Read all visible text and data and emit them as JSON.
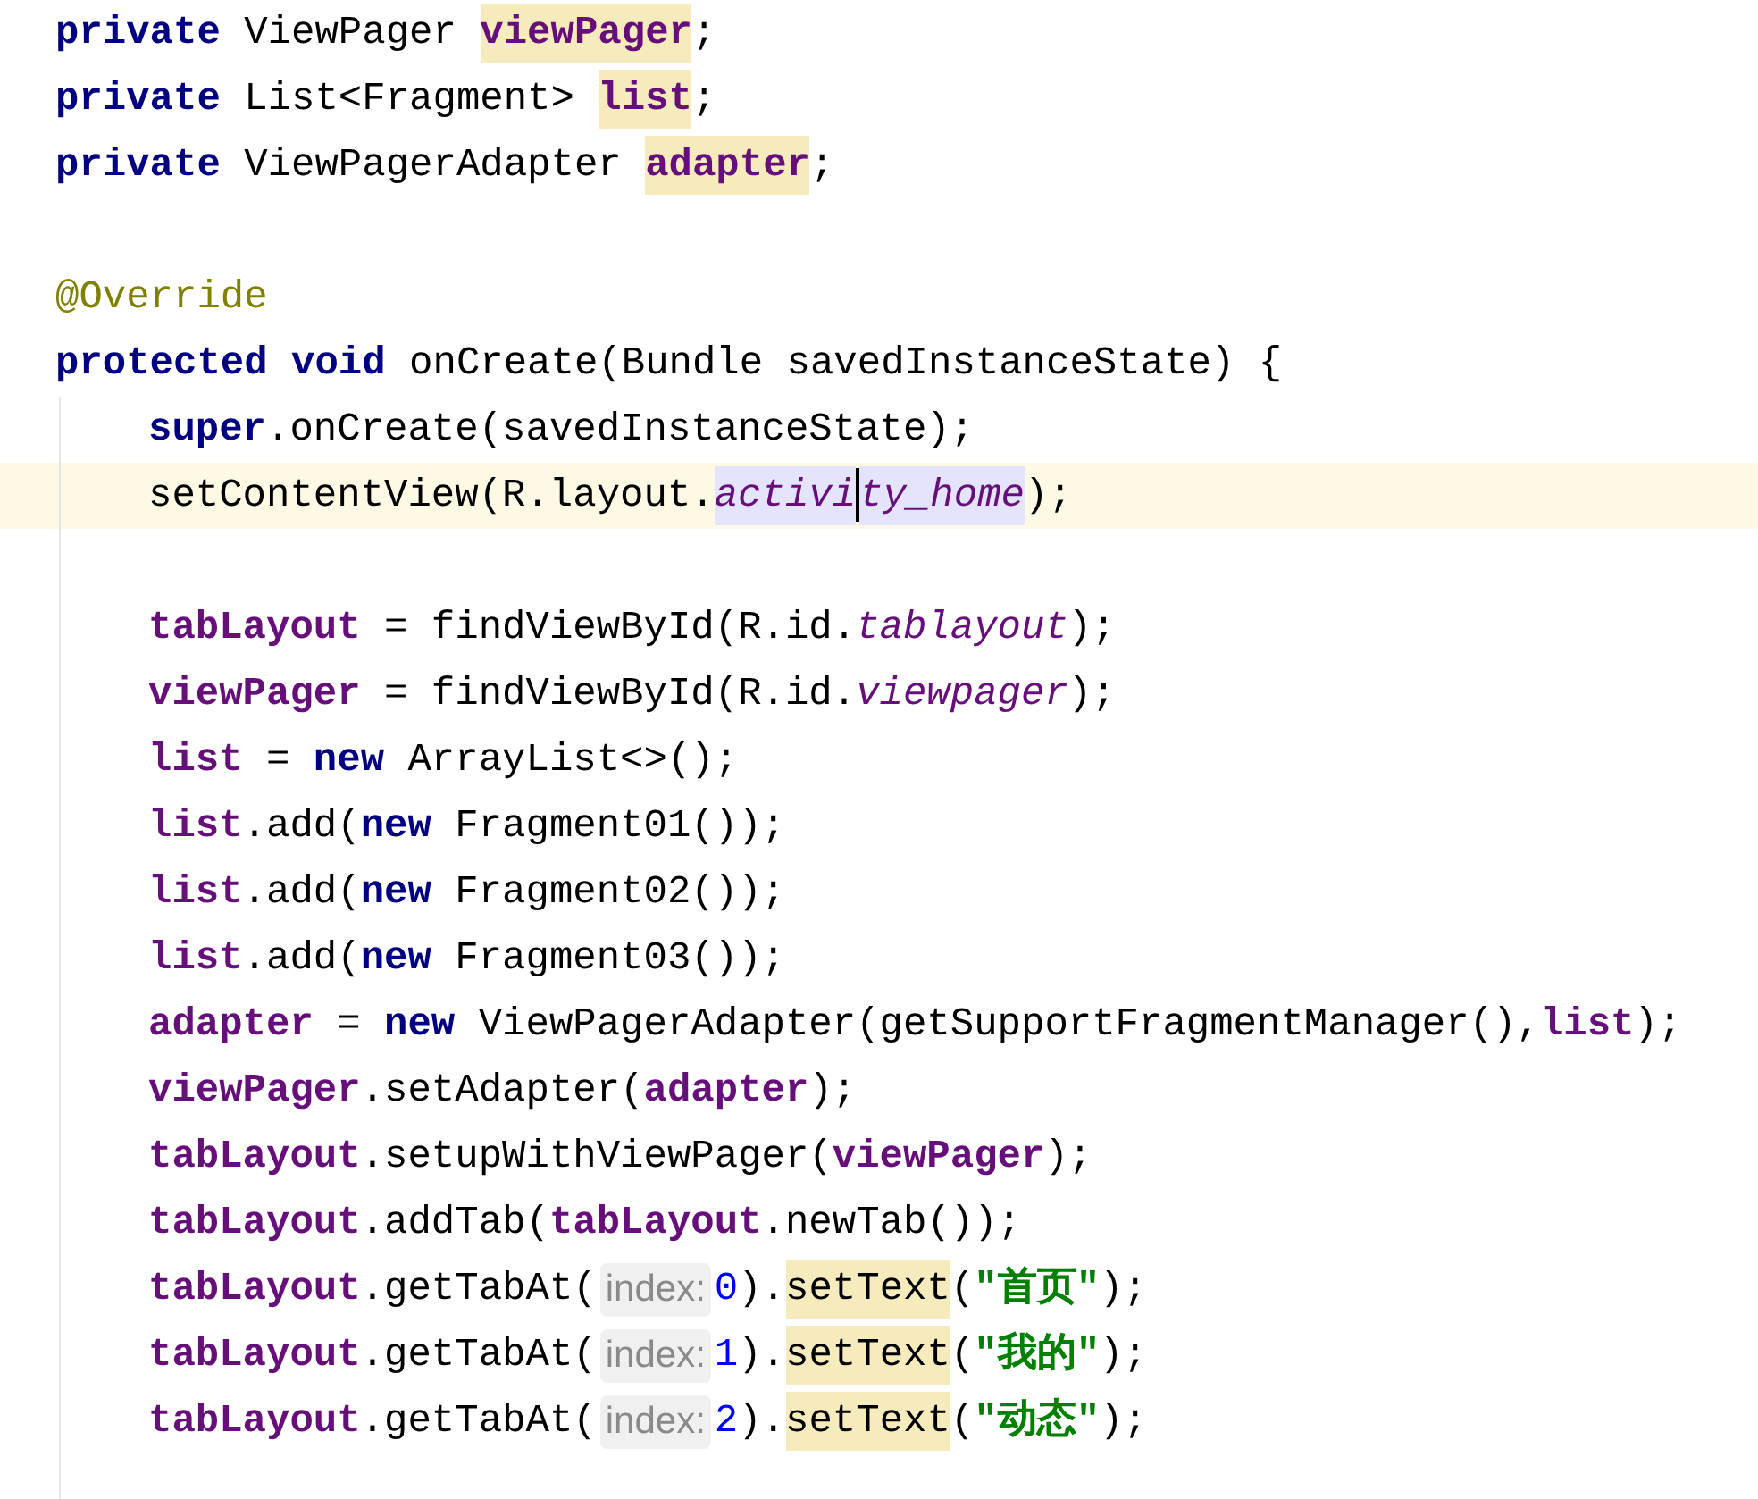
{
  "lines": [
    {
      "current": false,
      "tokens": [
        {
          "kind": "keyword",
          "text": "private"
        },
        {
          "kind": "plain",
          "text": " ViewPager "
        },
        {
          "kind": "field",
          "text": "viewPager",
          "usage_highlight": true
        },
        {
          "kind": "plain",
          "text": ";"
        }
      ]
    },
    {
      "current": false,
      "tokens": [
        {
          "kind": "keyword",
          "text": "private"
        },
        {
          "kind": "plain",
          "text": " List<Fragment> "
        },
        {
          "kind": "field",
          "text": "list",
          "usage_highlight": true
        },
        {
          "kind": "plain",
          "text": ";"
        }
      ]
    },
    {
      "current": false,
      "tokens": [
        {
          "kind": "keyword",
          "text": "private"
        },
        {
          "kind": "plain",
          "text": " ViewPagerAdapter "
        },
        {
          "kind": "field",
          "text": "adapter",
          "usage_highlight": true
        },
        {
          "kind": "plain",
          "text": ";"
        }
      ]
    },
    {
      "current": false
    },
    {
      "current": false,
      "tokens": [
        {
          "kind": "annotation",
          "text": "@Override"
        }
      ]
    },
    {
      "current": false,
      "tokens": [
        {
          "kind": "keyword",
          "text": "protected"
        },
        {
          "kind": "keyword",
          "text": " void"
        },
        {
          "kind": "plain",
          "text": " onCreate(Bundle savedInstanceState) {"
        }
      ],
      "children": [
        {
          "current": false,
          "tokens": [
            {
              "kind": "keyword",
              "text": "super"
            },
            {
              "kind": "plain",
              "text": ".onCreate(savedInstanceState);"
            }
          ]
        },
        {
          "current": true,
          "tokens": [
            {
              "kind": "plain",
              "text": "setContentView(R.layout."
            },
            {
              "kind": "static",
              "text": "activi",
              "caret_highlight": true
            },
            {
              "kind": "caret"
            },
            {
              "kind": "static",
              "text": "ty_home",
              "caret_highlight": true
            },
            {
              "kind": "plain",
              "text": ");"
            }
          ]
        },
        {
          "current": false
        },
        {
          "current": false,
          "tokens": [
            {
              "kind": "field",
              "text": "tabLayout"
            },
            {
              "kind": "plain",
              "text": " = findViewById(R.id."
            },
            {
              "kind": "static",
              "text": "tablayout"
            },
            {
              "kind": "plain",
              "text": ");"
            }
          ]
        },
        {
          "current": false,
          "tokens": [
            {
              "kind": "field",
              "text": "viewPager"
            },
            {
              "kind": "plain",
              "text": " = findViewById(R.id."
            },
            {
              "kind": "static",
              "text": "viewpager"
            },
            {
              "kind": "plain",
              "text": ");"
            }
          ]
        },
        {
          "current": false,
          "tokens": [
            {
              "kind": "field",
              "text": "list"
            },
            {
              "kind": "plain",
              "text": " = "
            },
            {
              "kind": "keyword",
              "text": "new"
            },
            {
              "kind": "plain",
              "text": " ArrayList<>();"
            }
          ]
        },
        {
          "current": false,
          "tokens": [
            {
              "kind": "field",
              "text": "list"
            },
            {
              "kind": "plain",
              "text": ".add("
            },
            {
              "kind": "keyword",
              "text": "new"
            },
            {
              "kind": "plain",
              "text": " Fragment01());"
            }
          ]
        },
        {
          "current": false,
          "tokens": [
            {
              "kind": "field",
              "text": "list"
            },
            {
              "kind": "plain",
              "text": ".add("
            },
            {
              "kind": "keyword",
              "text": "new"
            },
            {
              "kind": "plain",
              "text": " Fragment02());"
            }
          ]
        },
        {
          "current": false,
          "tokens": [
            {
              "kind": "field",
              "text": "list"
            },
            {
              "kind": "plain",
              "text": ".add("
            },
            {
              "kind": "keyword",
              "text": "new"
            },
            {
              "kind": "plain",
              "text": " Fragment03());"
            }
          ]
        },
        {
          "current": false,
          "tokens": [
            {
              "kind": "field",
              "text": "adapter"
            },
            {
              "kind": "plain",
              "text": " = "
            },
            {
              "kind": "keyword",
              "text": "new"
            },
            {
              "kind": "plain",
              "text": " ViewPagerAdapter(getSupportFragmentManager(),"
            },
            {
              "kind": "field",
              "text": "list"
            },
            {
              "kind": "plain",
              "text": ");"
            }
          ]
        },
        {
          "current": false,
          "tokens": [
            {
              "kind": "field",
              "text": "viewPager"
            },
            {
              "kind": "plain",
              "text": ".setAdapter("
            },
            {
              "kind": "field",
              "text": "adapter"
            },
            {
              "kind": "plain",
              "text": ");"
            }
          ]
        },
        {
          "current": false,
          "tokens": [
            {
              "kind": "field",
              "text": "tabLayout"
            },
            {
              "kind": "plain",
              "text": ".setupWithViewPager("
            },
            {
              "kind": "field",
              "text": "viewPager"
            },
            {
              "kind": "plain",
              "text": ");"
            }
          ]
        },
        {
          "current": false,
          "tokens": [
            {
              "kind": "field",
              "text": "tabLayout"
            },
            {
              "kind": "plain",
              "text": ".addTab("
            },
            {
              "kind": "field",
              "text": "tabLayout"
            },
            {
              "kind": "plain",
              "text": ".newTab());"
            }
          ]
        },
        {
          "current": false,
          "tokens": [
            {
              "kind": "field",
              "text": "tabLayout"
            },
            {
              "kind": "plain",
              "text": ".getTabAt("
            },
            {
              "kind": "hint",
              "text": "index:"
            },
            {
              "kind": "number",
              "text": "0"
            },
            {
              "kind": "plain",
              "text": ")."
            },
            {
              "kind": "plain",
              "text": "setText",
              "usage_highlight": true
            },
            {
              "kind": "plain",
              "text": "("
            },
            {
              "kind": "string",
              "text": "\"首页\""
            },
            {
              "kind": "plain",
              "text": ");"
            }
          ]
        },
        {
          "current": false,
          "tokens": [
            {
              "kind": "field",
              "text": "tabLayout"
            },
            {
              "kind": "plain",
              "text": ".getTabAt("
            },
            {
              "kind": "hint",
              "text": "index:"
            },
            {
              "kind": "number",
              "text": "1"
            },
            {
              "kind": "plain",
              "text": ")."
            },
            {
              "kind": "plain",
              "text": "setText",
              "usage_highlight": true
            },
            {
              "kind": "plain",
              "text": "("
            },
            {
              "kind": "string",
              "text": "\"我的\""
            },
            {
              "kind": "plain",
              "text": ");"
            }
          ]
        },
        {
          "current": false,
          "tokens": [
            {
              "kind": "field",
              "text": "tabLayout"
            },
            {
              "kind": "plain",
              "text": ".getTabAt("
            },
            {
              "kind": "hint",
              "text": "index:"
            },
            {
              "kind": "number",
              "text": "2"
            },
            {
              "kind": "plain",
              "text": ")."
            },
            {
              "kind": "plain",
              "text": "setText",
              "usage_highlight": true
            },
            {
              "kind": "plain",
              "text": "("
            },
            {
              "kind": "string",
              "text": "\"动态\""
            },
            {
              "kind": "plain",
              "text": ");"
            }
          ]
        }
      ]
    }
  ]
}
